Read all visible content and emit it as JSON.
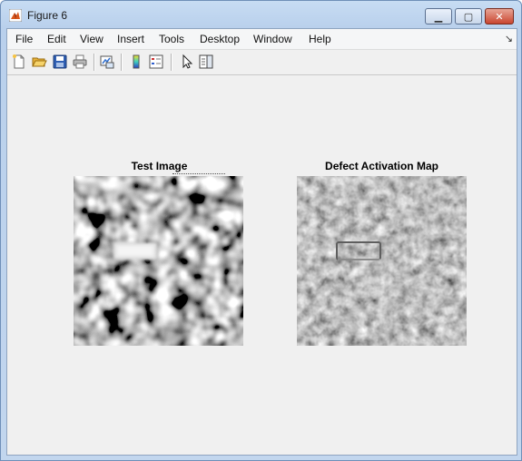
{
  "window": {
    "title": "Figure 6",
    "controls": {
      "minimize": "▁",
      "maximize": "▢",
      "close": "✕"
    }
  },
  "menubar": {
    "items": [
      "File",
      "Edit",
      "View",
      "Insert",
      "Tools",
      "Desktop",
      "Window",
      "Help"
    ],
    "dock_arrow": "↘"
  },
  "toolbar": {
    "icons": [
      "new-figure-icon",
      "open-file-icon",
      "save-icon",
      "print-icon",
      "link-plot-icon",
      "colorbar-icon",
      "legend-icon",
      "select-pointer-icon",
      "property-editor-icon"
    ]
  },
  "plots": [
    {
      "title": "Test Image",
      "kind": "grayscale texture with bright rectangular defect"
    },
    {
      "title": "Defect Activation Map",
      "kind": "mid-gray relief activation map"
    }
  ],
  "colors": {
    "title_bar": "#c7dcf3",
    "client_bg": "#f0f0f0",
    "close_button": "#c9452f"
  }
}
